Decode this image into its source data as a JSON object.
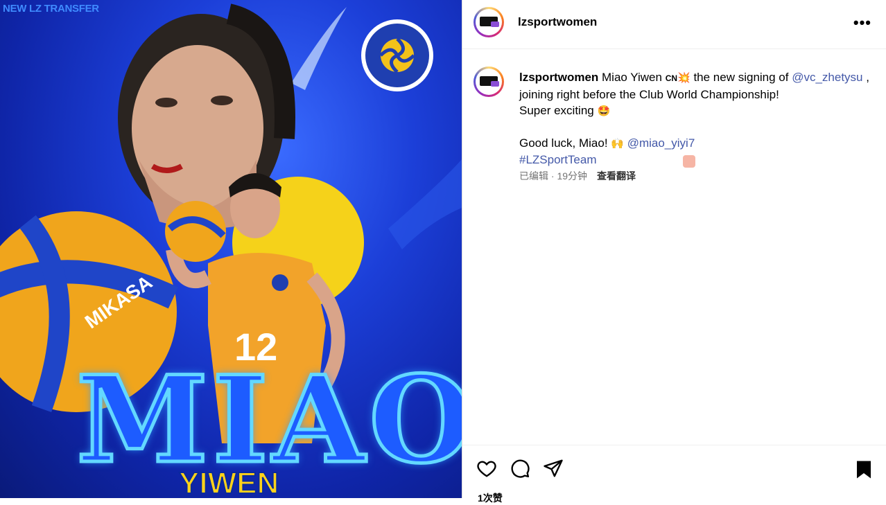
{
  "poster": {
    "tag": "NEW LZ TRANSFER",
    "name": "MIAO",
    "subname": "YIWEN",
    "ball_brand": "MIKASA",
    "jersey_number": "12"
  },
  "header": {
    "username": "lzsportwomen",
    "more": "•••"
  },
  "caption": {
    "username": "lzsportwomen",
    "text1": " Miao Yiwen ",
    "country": "CN",
    "emoji1": "💥",
    "text2": " the new signing of ",
    "mention1": "@vc_zhetysu",
    "text3": " , joining right before the Club World Championship!",
    "line2": "Super exciting ",
    "emoji2": "🤩",
    "line3": "Good luck, Miao! ",
    "emoji3": "🙌",
    "mention2": "@miao_yiyi7",
    "hashtag": "#LZSportTeam"
  },
  "meta": {
    "edited": "已编辑 · 19分钟",
    "translate": "查看翻译"
  },
  "likes": "1次赞",
  "icons": [
    "heart-icon",
    "comment-icon",
    "share-icon",
    "bookmark-icon",
    "more-icon"
  ]
}
